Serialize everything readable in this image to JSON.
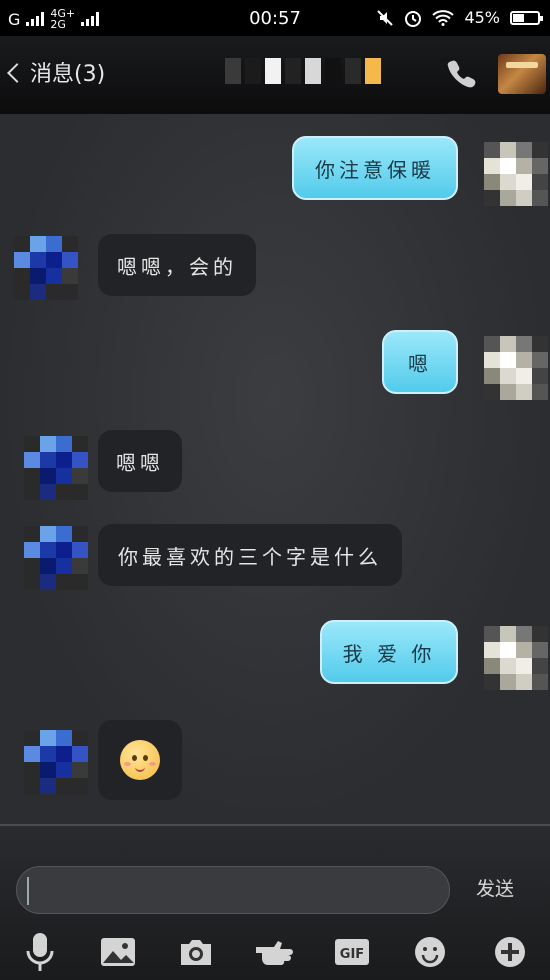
{
  "status_bar": {
    "carrier": "G",
    "network_top": "4G+",
    "network_bottom": "2G",
    "time": "00:57",
    "battery": "45%",
    "battery_level": 0.45
  },
  "nav": {
    "back_label": "消息(3)"
  },
  "messages": [
    {
      "direction": "out",
      "text": "你注意保暖"
    },
    {
      "direction": "in",
      "text": "嗯嗯，会的"
    },
    {
      "direction": "out",
      "text": "嗯"
    },
    {
      "direction": "in",
      "text": "嗯嗯"
    },
    {
      "direction": "in",
      "text": "你最喜欢的三个字是什么"
    },
    {
      "direction": "out",
      "text": "我 爱 你"
    },
    {
      "direction": "in",
      "emoji": "shy-smile-emoji"
    }
  ],
  "input": {
    "placeholder": "",
    "send_label": "发送"
  },
  "toolbar": {
    "icons": [
      "microphone-icon",
      "image-icon",
      "camera-icon",
      "poke-icon",
      "gif-icon",
      "emoji-icon",
      "plus-icon"
    ],
    "gif_label": "GIF"
  },
  "colors": {
    "outgoing_bubble": "#6fd6f0",
    "incoming_bubble": "#222326",
    "background": "#2f3134"
  }
}
